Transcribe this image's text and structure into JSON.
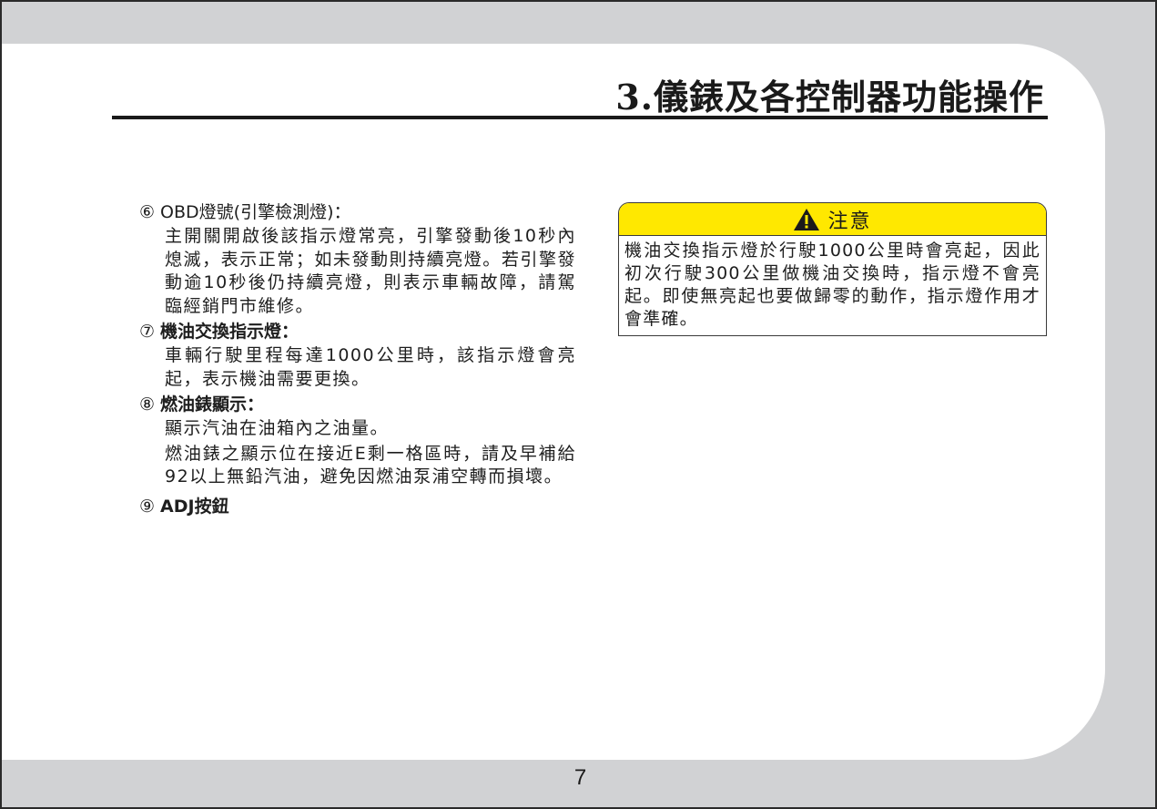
{
  "page": {
    "title": "3.儀錶及各控制器功能操作",
    "page_number": "7"
  },
  "items": [
    {
      "number": "⑥",
      "heading": "OBD燈號(引擎檢測燈)：",
      "paragraphs": [
        "主開關開啟後該指示燈常亮，引擎發動後10秒內熄滅，表示正常；如未發動則持續亮燈。若引擎發動逾10秒後仍持續亮燈，則表示車輛故障，請駕臨經銷門市維修。"
      ]
    },
    {
      "number": "⑦",
      "heading": "機油交換指示燈：",
      "paragraphs": [
        "車輛行駛里程每達1000公里時，該指示燈會亮起，表示機油需要更換。"
      ]
    },
    {
      "number": "⑧",
      "heading": "燃油錶顯示：",
      "paragraphs": [
        "顯示汽油在油箱內之油量。",
        "燃油錶之顯示位在接近E剩一格區時，請及早補給92以上無鉛汽油，避免因燃油泵浦空轉而損壞。"
      ]
    },
    {
      "number": "⑨",
      "heading": "ADJ按鈕",
      "paragraphs": []
    }
  ],
  "caution": {
    "icon": "warning-triangle-icon",
    "title": "注意",
    "text": "機油交換指示燈於行駛1000公里時會亮起，因此初次行駛300公里做機油交換時，指示燈不會亮起。即使無亮起也要做歸零的動作，指示燈作用才會準確。",
    "header_color": "#ffe800"
  },
  "colors": {
    "page_margin": "#d1d2d4",
    "page": "#ffffff",
    "text": "#1e1e1e"
  }
}
